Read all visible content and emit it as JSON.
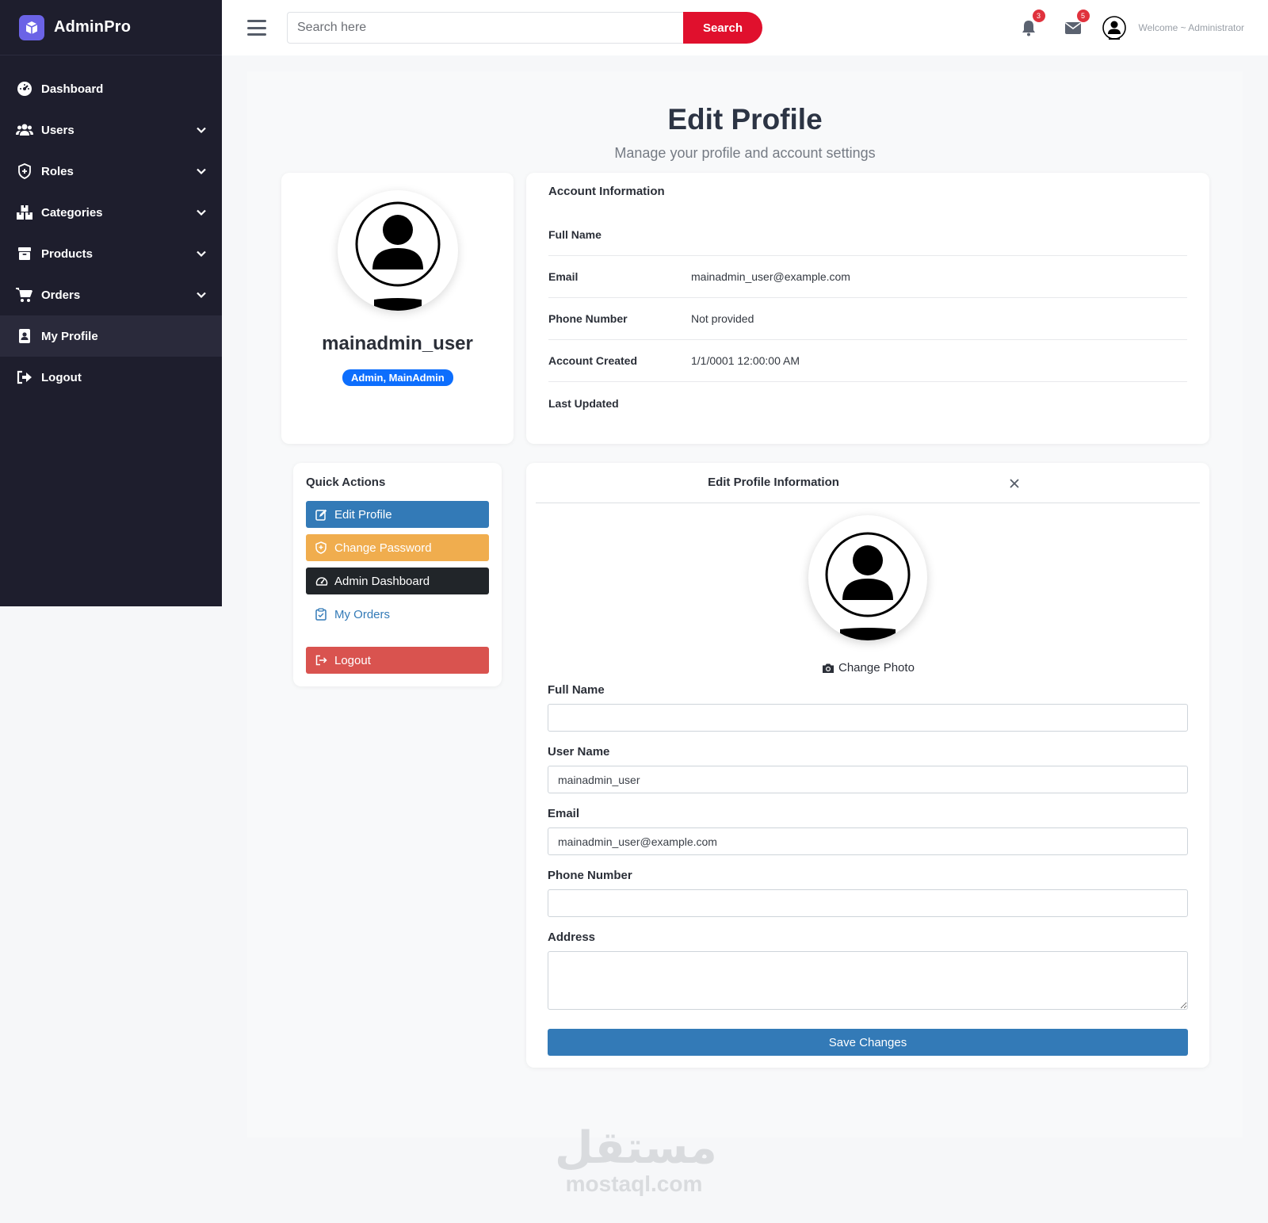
{
  "sidebar": {
    "brand": "AdminPro",
    "items": [
      {
        "label": "Dashboard",
        "icon": "dashboard-gauge-icon",
        "has_submenu": false,
        "active": false
      },
      {
        "label": "Users",
        "icon": "users-icon",
        "has_submenu": true,
        "active": false
      },
      {
        "label": "Roles",
        "icon": "shield-icon",
        "has_submenu": true,
        "active": false
      },
      {
        "label": "Categories",
        "icon": "boxes-icon",
        "has_submenu": true,
        "active": false
      },
      {
        "label": "Products",
        "icon": "box-icon",
        "has_submenu": true,
        "active": false
      },
      {
        "label": "Orders",
        "icon": "cart-icon",
        "has_submenu": true,
        "active": false
      },
      {
        "label": "My Profile",
        "icon": "id-badge-icon",
        "has_submenu": false,
        "active": true
      },
      {
        "label": "Logout",
        "icon": "logout-icon",
        "has_submenu": false,
        "active": false
      }
    ]
  },
  "header": {
    "search_placeholder": "Search here",
    "search_button": "Search",
    "notifications_count": "3",
    "messages_count": "5",
    "welcome": "Welcome ~ Administrator"
  },
  "page": {
    "title": "Edit Profile",
    "subtitle": "Manage your profile and account settings"
  },
  "profile": {
    "username": "mainadmin_user",
    "roles": "Admin, MainAdmin"
  },
  "account": {
    "title": "Account Information",
    "rows": [
      {
        "label": "Full Name",
        "value": ""
      },
      {
        "label": "Email",
        "value": "mainadmin_user@example.com"
      },
      {
        "label": "Phone Number",
        "value": "Not provided"
      },
      {
        "label": "Account Created",
        "value": "1/1/0001 12:00:00 AM"
      },
      {
        "label": "Last Updated",
        "value": ""
      }
    ]
  },
  "quick_actions": {
    "title": "Quick Actions",
    "edit_profile": "Edit Profile",
    "change_password": "Change Password",
    "admin_dashboard": "Admin Dashboard",
    "my_orders": "My Orders",
    "logout": "Logout"
  },
  "edit_form": {
    "title": "Edit Profile Information",
    "change_photo": "Change Photo",
    "full_name_label": "Full Name",
    "full_name_value": "",
    "user_name_label": "User Name",
    "user_name_value": "mainadmin_user",
    "email_label": "Email",
    "email_value": "mainadmin_user@example.com",
    "phone_label": "Phone Number",
    "phone_value": "",
    "address_label": "Address",
    "address_value": "",
    "save_button": "Save Changes"
  },
  "watermark": {
    "arabic": "مستقل",
    "latin": "mostaql.com"
  },
  "colors": {
    "sidebar_bg": "#1e1e2d",
    "brand_accent": "#6b63e6",
    "search_button": "#e0102d",
    "primary": "#337ab7",
    "warning": "#f0ad4e",
    "dark": "#212529",
    "danger": "#d9534f",
    "role_badge": "#0d6efd"
  }
}
